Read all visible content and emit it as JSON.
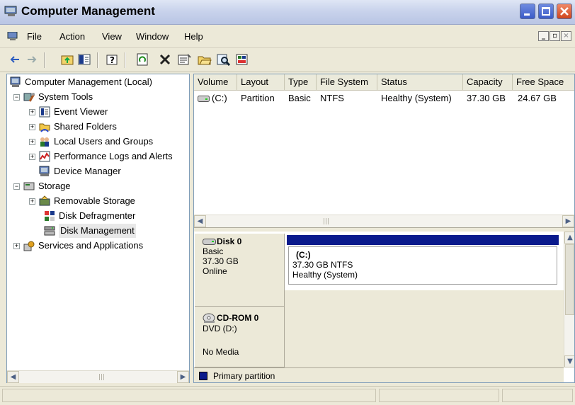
{
  "window": {
    "title": "Computer Management"
  },
  "menu": [
    "File",
    "Action",
    "View",
    "Window",
    "Help"
  ],
  "toolbar": {
    "icons": [
      "back-arrow-icon",
      "forward-arrow-icon",
      "up-folder-icon",
      "show-hide-tree-icon",
      "help-icon",
      "refresh-icon",
      "delete-icon",
      "properties-icon",
      "open-icon",
      "search-icon",
      "disk-properties-icon"
    ]
  },
  "tree": {
    "root": "Computer Management (Local)",
    "system_tools": "System Tools",
    "event_viewer": "Event Viewer",
    "shared_folders": "Shared Folders",
    "local_users": "Local Users and Groups",
    "perf_logs": "Performance Logs and Alerts",
    "device_manager": "Device Manager",
    "storage": "Storage",
    "removable_storage": "Removable Storage",
    "disk_defrag": "Disk Defragmenter",
    "disk_management": "Disk Management",
    "services_apps": "Services and Applications"
  },
  "volume_list": {
    "columns": [
      "Volume",
      "Layout",
      "Type",
      "File System",
      "Status",
      "Capacity",
      "Free Space"
    ],
    "row": {
      "volume": "(C:)",
      "layout": "Partition",
      "type": "Basic",
      "file_system": "NTFS",
      "status": "Healthy (System)",
      "capacity": "37.30 GB",
      "free_space": "24.67 GB"
    }
  },
  "disk0": {
    "name": "Disk 0",
    "type": "Basic",
    "size": "37.30 GB",
    "state": "Online",
    "partition": {
      "name": "(C:)",
      "size_fs": "37.30 GB NTFS",
      "status": "Healthy (System)"
    }
  },
  "cdrom0": {
    "name": "CD-ROM 0",
    "drive": "DVD (D:)",
    "media": "No Media"
  },
  "legend": {
    "label": "Primary partition",
    "color": "#0a1a8c"
  }
}
